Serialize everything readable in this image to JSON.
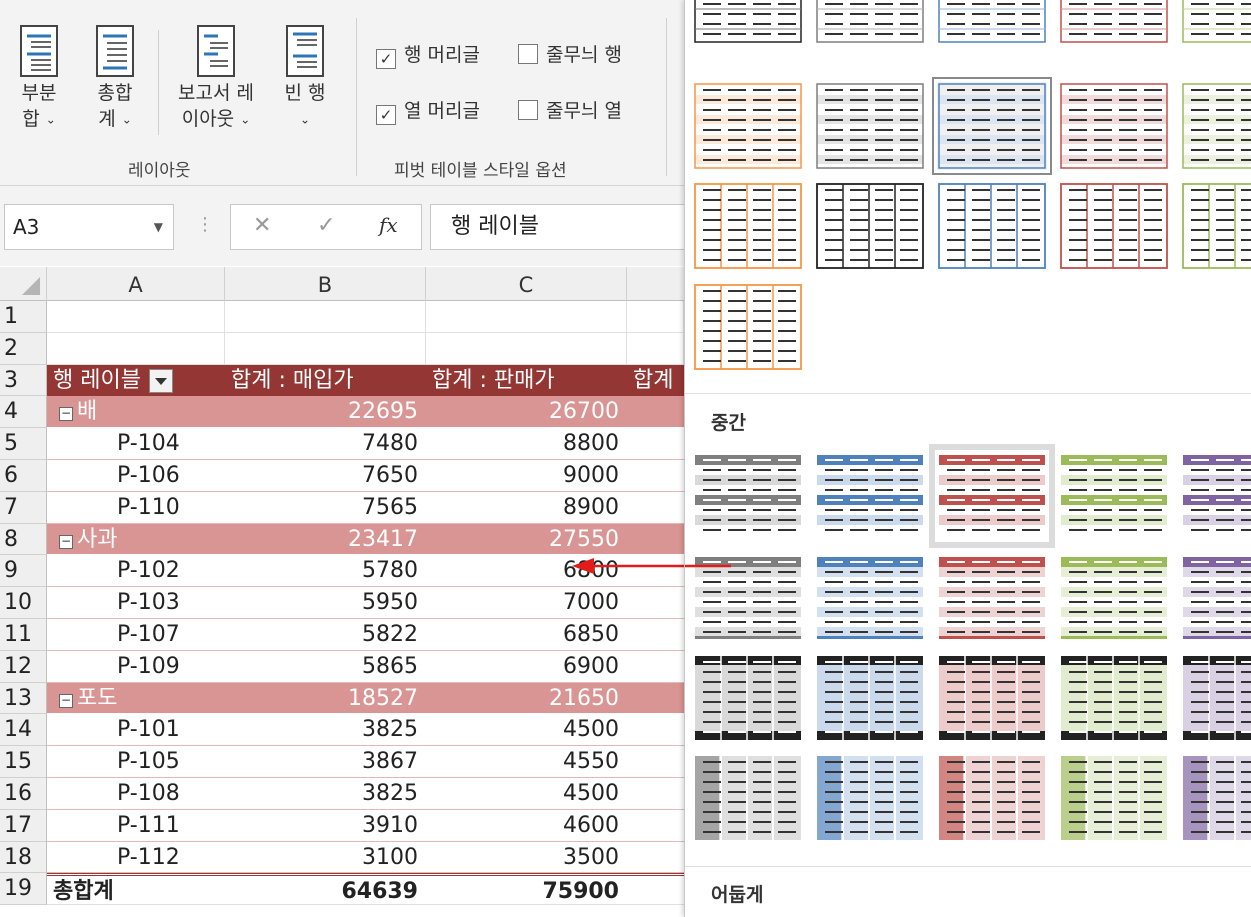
{
  "ribbon": {
    "layout_group": {
      "label": "레이아웃",
      "buttons": [
        {
          "id": "subtotals",
          "line1": "부분",
          "line2": "합"
        },
        {
          "id": "grandtotals",
          "line1": "총합",
          "line2": "계"
        },
        {
          "id": "report_layout",
          "line1": "보고서 레",
          "line2": "이아웃"
        },
        {
          "id": "blank_rows",
          "line1": "빈 행",
          "line2": ""
        }
      ]
    },
    "options_group": {
      "label": "피벗 테이블 스타일 옵션",
      "row_headers": {
        "label": "행 머리글",
        "checked": true
      },
      "banded_rows": {
        "label": "줄무늬 행",
        "checked": false
      },
      "col_headers": {
        "label": "열 머리글",
        "checked": true
      },
      "banded_cols": {
        "label": "줄무늬 열",
        "checked": false
      }
    }
  },
  "formula_bar": {
    "name_box": "A3",
    "cancel_glyph": "✕",
    "enter_glyph": "✓",
    "fx_label": "fx",
    "value": "행 레이블"
  },
  "sheet": {
    "columns": [
      "A",
      "B",
      "C"
    ],
    "rows": [
      {
        "num": "1",
        "type": "blank",
        "a": "",
        "b": "",
        "c": ""
      },
      {
        "num": "2",
        "type": "blank",
        "a": "",
        "b": "",
        "c": ""
      },
      {
        "num": "3",
        "type": "header",
        "a": "행 레이블",
        "b": "합계 : 매입가",
        "c": "합계 : 판매가",
        "d": "합계"
      },
      {
        "num": "4",
        "type": "group",
        "a": "배",
        "b": "22695",
        "c": "26700"
      },
      {
        "num": "5",
        "type": "detail",
        "a": "P-104",
        "b": "7480",
        "c": "8800"
      },
      {
        "num": "6",
        "type": "detail",
        "a": "P-106",
        "b": "7650",
        "c": "9000"
      },
      {
        "num": "7",
        "type": "detail",
        "a": "P-110",
        "b": "7565",
        "c": "8900"
      },
      {
        "num": "8",
        "type": "group",
        "a": "사과",
        "b": "23417",
        "c": "27550"
      },
      {
        "num": "9",
        "type": "detail",
        "a": "P-102",
        "b": "5780",
        "c": "6800"
      },
      {
        "num": "10",
        "type": "detail",
        "a": "P-103",
        "b": "5950",
        "c": "7000"
      },
      {
        "num": "11",
        "type": "detail",
        "a": "P-107",
        "b": "5822",
        "c": "6850"
      },
      {
        "num": "12",
        "type": "detail",
        "a": "P-109",
        "b": "5865",
        "c": "6900"
      },
      {
        "num": "13",
        "type": "group",
        "a": "포도",
        "b": "18527",
        "c": "21650"
      },
      {
        "num": "14",
        "type": "detail",
        "a": "P-101",
        "b": "3825",
        "c": "4500"
      },
      {
        "num": "15",
        "type": "detail",
        "a": "P-105",
        "b": "3867",
        "c": "4550"
      },
      {
        "num": "16",
        "type": "detail",
        "a": "P-108",
        "b": "3825",
        "c": "4500"
      },
      {
        "num": "17",
        "type": "detail",
        "a": "P-111",
        "b": "3910",
        "c": "4600"
      },
      {
        "num": "18",
        "type": "detail",
        "a": "P-112",
        "b": "3100",
        "c": "3500"
      },
      {
        "num": "19",
        "type": "total",
        "a": "총합계",
        "b": "64639",
        "c": "75900"
      }
    ]
  },
  "gallery": {
    "sections": [
      {
        "label": "중간"
      },
      {
        "label": "어둡게"
      }
    ],
    "palette": {
      "gray": "#7f7f7f",
      "blue": "#4f81bd",
      "red": "#c0504d",
      "green": "#9bbb59",
      "purple": "#8064a2",
      "orange": "#f79646",
      "black": "#222222",
      "pivot_header": "#943634",
      "pivot_group": "#d99594"
    }
  }
}
